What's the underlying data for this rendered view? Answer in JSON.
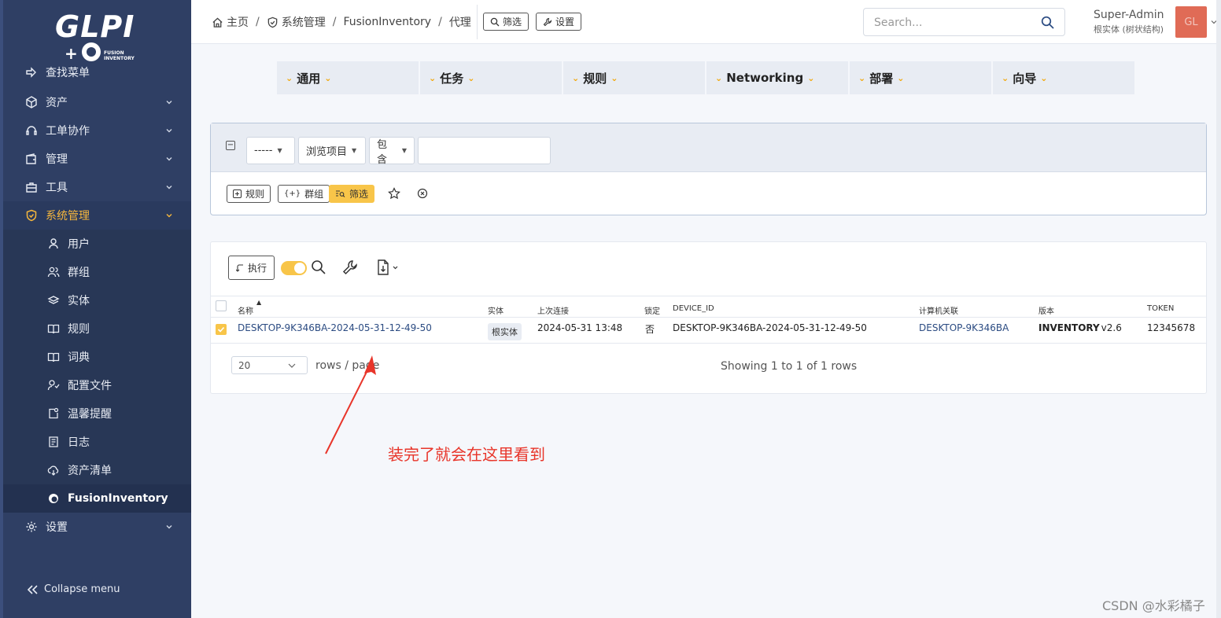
{
  "sidebar": {
    "items": [
      {
        "label": "查找菜单",
        "icon": "arrow-right-icon"
      },
      {
        "label": "资产",
        "icon": "cube-icon"
      },
      {
        "label": "工单协作",
        "icon": "headset-icon"
      },
      {
        "label": "管理",
        "icon": "wallet-icon"
      },
      {
        "label": "工具",
        "icon": "briefcase-icon"
      },
      {
        "label": "系统管理",
        "icon": "shield-icon"
      },
      {
        "label": "设置",
        "icon": "gear-icon"
      }
    ],
    "sub_items": [
      {
        "label": "用户",
        "icon": "user-icon"
      },
      {
        "label": "群组",
        "icon": "users-icon"
      },
      {
        "label": "实体",
        "icon": "stack-icon"
      },
      {
        "label": "规则",
        "icon": "book-icon"
      },
      {
        "label": "词典",
        "icon": "book-icon"
      },
      {
        "label": "配置文件",
        "icon": "user-check-icon"
      },
      {
        "label": "温馨提醒",
        "icon": "note-icon"
      },
      {
        "label": "日志",
        "icon": "log-icon"
      },
      {
        "label": "资产清单",
        "icon": "cloud-download-icon"
      },
      {
        "label": "FusionInventory",
        "icon": "fusion-icon"
      }
    ],
    "collapse_label": "Collapse menu",
    "logo_text": "GLPI",
    "logo_sub": "FUSION INVENTORY"
  },
  "header": {
    "breadcrumb": [
      "主页",
      "系统管理",
      "FusionInventory",
      "代理"
    ],
    "filter_button": "筛选",
    "settings_button": "设置",
    "search_placeholder": "Search...",
    "user_name": "Super-Admin",
    "user_entity": "根实体 (树状结构)",
    "avatar_initials": "GL"
  },
  "plugin_menu": [
    "通用",
    "任务",
    "规则",
    "Networking",
    "部署",
    "向导"
  ],
  "criteria": {
    "field_select": "-----",
    "browse_select": "浏览项目",
    "operator_select": "包含",
    "value_input": "",
    "rule_button": "规则",
    "group_button": "群组",
    "filter_button": "筛选"
  },
  "results": {
    "execute_button": "执行",
    "columns": [
      "名称",
      "实体",
      "上次连接",
      "锁定",
      "DEVICE_ID",
      "计算机关联",
      "版本",
      "TOKEN"
    ],
    "rows": [
      {
        "name": "DESKTOP-9K346BA-2024-05-31-12-49-50",
        "entity": "根实体",
        "last_contact": "2024-05-31 13:48",
        "locked": "否",
        "device_id": "DESKTOP-9K346BA-2024-05-31-12-49-50",
        "computer": "DESKTOP-9K346BA",
        "version_label": "INVENTORY",
        "version_value": " : v2.6",
        "token": "12345678"
      }
    ],
    "page_size": "20",
    "rows_per_page": "rows / page",
    "showing": "Showing 1 to 1 of 1 rows"
  },
  "annotation": "装完了就会在这里看到",
  "watermark": "CSDN @水彩橘子",
  "colors": {
    "sidebar": "#2f3f64",
    "accent": "#f8c549",
    "annotation": "#e8352a"
  }
}
